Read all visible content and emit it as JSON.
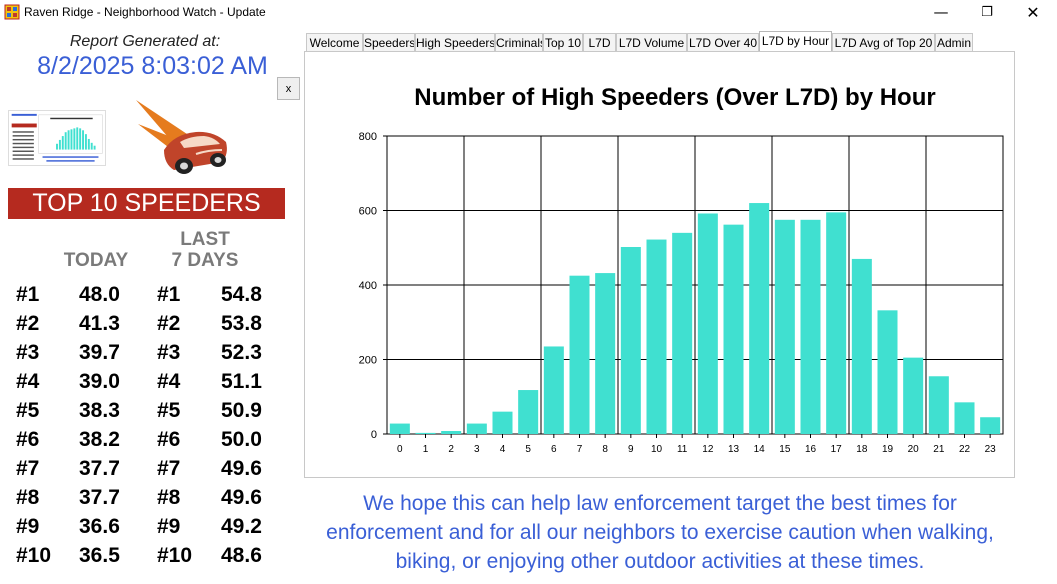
{
  "window": {
    "title": "Raven Ridge - Neighborhood Watch - Update",
    "min_glyph": "—",
    "max_glyph": "❐",
    "close_glyph": "✕"
  },
  "report": {
    "label": "Report Generated at:",
    "timestamp": "8/2/2025 8:03:02 AM",
    "close_button": "x"
  },
  "top10": {
    "banner": "TOP 10 SPEEDERS",
    "today_header": "TODAY",
    "last7_header_line1": "LAST",
    "last7_header_line2": "7 DAYS",
    "rows": [
      {
        "rank": "#1",
        "today": "48.0",
        "rank2": "#1",
        "last7": "54.8"
      },
      {
        "rank": "#2",
        "today": "41.3",
        "rank2": "#2",
        "last7": "53.8"
      },
      {
        "rank": "#3",
        "today": "39.7",
        "rank2": "#3",
        "last7": "52.3"
      },
      {
        "rank": "#4",
        "today": "39.0",
        "rank2": "#4",
        "last7": "51.1"
      },
      {
        "rank": "#5",
        "today": "38.3",
        "rank2": "#5",
        "last7": "50.9"
      },
      {
        "rank": "#6",
        "today": "38.2",
        "rank2": "#6",
        "last7": "50.0"
      },
      {
        "rank": "#7",
        "today": "37.7",
        "rank2": "#7",
        "last7": "49.6"
      },
      {
        "rank": "#8",
        "today": "37.7",
        "rank2": "#8",
        "last7": "49.6"
      },
      {
        "rank": "#9",
        "today": "36.6",
        "rank2": "#9",
        "last7": "49.2"
      },
      {
        "rank": "#10",
        "today": "36.5",
        "rank2": "#10",
        "last7": "48.6"
      }
    ]
  },
  "tabs": [
    {
      "label": "Welcome"
    },
    {
      "label": "Speeders"
    },
    {
      "label": "High Speeders"
    },
    {
      "label": "Criminals"
    },
    {
      "label": "Top 10"
    },
    {
      "label": "L7D"
    },
    {
      "label": "L7D Volume"
    },
    {
      "label": "L7D Over 40"
    },
    {
      "label": "L7D by Hour",
      "active": true
    },
    {
      "label": "L7D Avg of Top 20"
    },
    {
      "label": "Admin"
    }
  ],
  "colors": {
    "bar": "#40e0d0",
    "title_blue": "#3a5fd6",
    "banner_red": "#b52a1f"
  },
  "chart_data": {
    "type": "bar",
    "title": "Number of High Speeders (Over L7D) by Hour",
    "xlabel": "",
    "ylabel": "",
    "categories": [
      "0",
      "1",
      "2",
      "3",
      "4",
      "5",
      "6",
      "7",
      "8",
      "9",
      "10",
      "11",
      "12",
      "13",
      "14",
      "15",
      "16",
      "17",
      "18",
      "19",
      "20",
      "21",
      "22",
      "23"
    ],
    "values": [
      28,
      3,
      8,
      28,
      60,
      118,
      235,
      425,
      432,
      502,
      522,
      540,
      592,
      562,
      620,
      575,
      575,
      595,
      470,
      332,
      205,
      155,
      85,
      45
    ],
    "ylim": [
      0,
      800
    ],
    "yticks": [
      0,
      200,
      400,
      600,
      800
    ],
    "grid": true
  },
  "note": "We hope this can help law enforcement target the best times for enforcement and for all our neighbors to exercise caution when walking, biking, or enjoying other outdoor activities at these times."
}
